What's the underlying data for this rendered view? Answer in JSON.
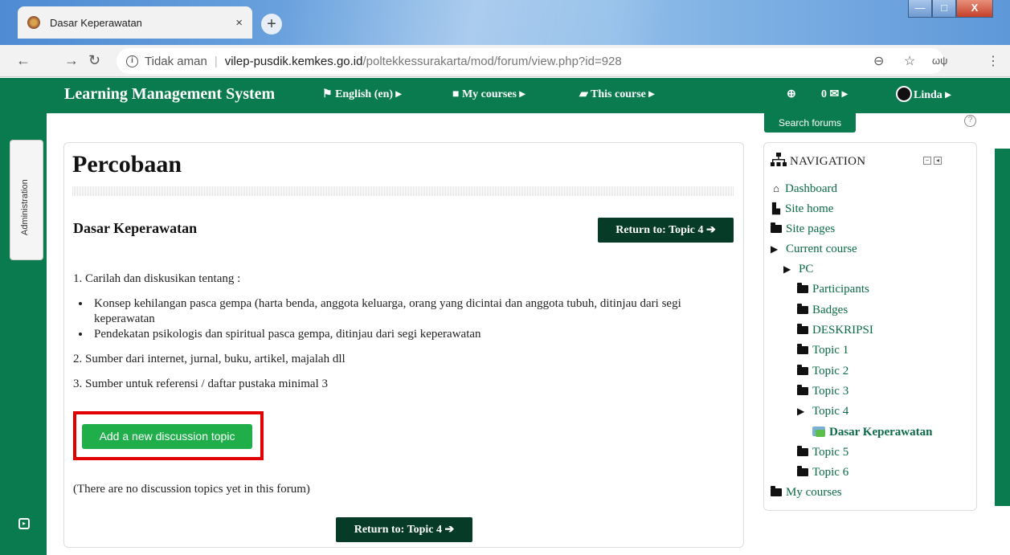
{
  "browser": {
    "tab_title": "Dasar Keperawatan",
    "tab_close": "×",
    "new_tab": "+",
    "security_label": "Tidak aman",
    "url_host": "vilep-pusdik.kemkes.go.id",
    "url_path": "/poltekkessurakarta/mod/forum/view.php?id=928",
    "window_controls": {
      "minimize": "—",
      "maximize": "□",
      "close": "X"
    }
  },
  "navbar": {
    "brand": "Learning Management System",
    "language": "English (en)",
    "my_courses": "My courses",
    "this_course": "This course",
    "messages_count": "0",
    "user_name": "Linda"
  },
  "sidebar": {
    "administration_label": "Administration"
  },
  "search_forums": "Search forums",
  "main": {
    "page_title": "Percobaan",
    "forum_name": "Dasar Keperawatan",
    "return_label": "Return to: Topic 4",
    "intro": {
      "item1": "1. Carilah dan diskusikan tentang :",
      "bullets": [
        "Konsep kehilangan pasca gempa (harta benda, anggota keluarga, orang yang dicintai dan anggota tubuh, ditinjau dari segi keperawatan",
        "Pendekatan psikologis dan spiritual pasca gempa, ditinjau dari segi keperawatan"
      ],
      "item2": "2. Sumber dari internet, jurnal, buku, artikel, majalah dll",
      "item3": "3. Sumber untuk referensi / daftar pustaka minimal 3"
    },
    "add_topic_button": "Add a new discussion topic",
    "no_topics": "(There are no discussion topics yet in this forum)"
  },
  "navigation": {
    "heading": "NAVIGATION",
    "items": [
      {
        "label": "Dashboard",
        "icon": "home-icon"
      },
      {
        "label": "Site home",
        "icon": "page-icon"
      },
      {
        "label": "Site pages",
        "icon": "folder-icon"
      },
      {
        "label": "Current course",
        "icon": "folder-open-icon"
      },
      {
        "label": "PC",
        "icon": "folder-open-icon"
      },
      {
        "label": "Participants",
        "icon": "folder-icon"
      },
      {
        "label": "Badges",
        "icon": "folder-icon"
      },
      {
        "label": "DESKRIPSI",
        "icon": "folder-icon"
      },
      {
        "label": "Topic 1",
        "icon": "folder-icon"
      },
      {
        "label": "Topic 2",
        "icon": "folder-icon"
      },
      {
        "label": "Topic 3",
        "icon": "folder-icon"
      },
      {
        "label": "Topic 4",
        "icon": "folder-open-icon"
      },
      {
        "label": "Dasar Keperawatan",
        "icon": "forum-icon"
      },
      {
        "label": "Topic 5",
        "icon": "folder-icon"
      },
      {
        "label": "Topic 6",
        "icon": "folder-icon"
      },
      {
        "label": "My courses",
        "icon": "folder-icon"
      }
    ]
  },
  "colors": {
    "brand_green": "#0a7b4f",
    "dark_button": "#063b27",
    "add_button": "#1fae4a",
    "highlight": "#e00000"
  }
}
